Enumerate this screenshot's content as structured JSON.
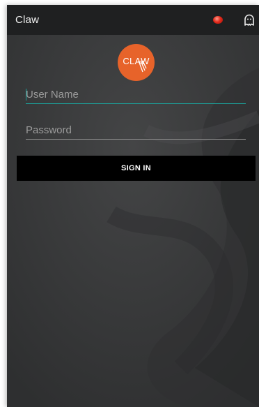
{
  "app": {
    "title": "Claw",
    "record_indicator_icon": "record-dot-icon",
    "profile_icon": "ghost-icon"
  },
  "logo": {
    "text": "CLAW",
    "color": "#e7632a"
  },
  "form": {
    "username": {
      "placeholder": "User Name",
      "value": ""
    },
    "password": {
      "placeholder": "Password",
      "value": ""
    },
    "signin_label": "SIGN IN"
  },
  "colors": {
    "action_bar": "#1f2021",
    "background": "#3b3b3b",
    "focus_accent": "#1ba39c",
    "button": "#000000"
  }
}
